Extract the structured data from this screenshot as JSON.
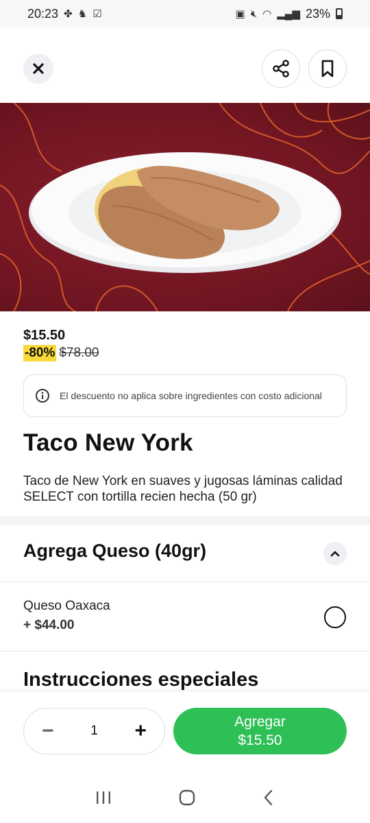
{
  "status_bar": {
    "time": "20:23",
    "battery": "23%"
  },
  "product": {
    "price": "$15.50",
    "discount": "-80%",
    "original_price": "$78.00",
    "notice": "El descuento no aplica sobre ingredientes con costo adicional",
    "title": "Taco New York",
    "description": "Taco de New York en suaves y jugosas láminas calidad SELECT con tortilla recien hecha (50 gr)"
  },
  "addon_section": {
    "title": "Agrega Queso (40gr)",
    "options": [
      {
        "name": "Queso Oaxaca",
        "price": "+ $44.00",
        "selected": false
      }
    ]
  },
  "special_instructions": {
    "title": "Instrucciones especiales"
  },
  "cart": {
    "quantity": "1",
    "minus": "−",
    "plus": "+",
    "add_label": "Agregar",
    "add_price": "$15.50"
  },
  "colors": {
    "accent_green": "#2fbf57",
    "discount_yellow": "#f9d93a",
    "hero_bg": "#6e1521"
  },
  "icons": {
    "close": "close-icon",
    "share": "share-icon",
    "bookmark": "bookmark-icon",
    "info": "info-icon",
    "chevron": "chevron-up-icon"
  }
}
